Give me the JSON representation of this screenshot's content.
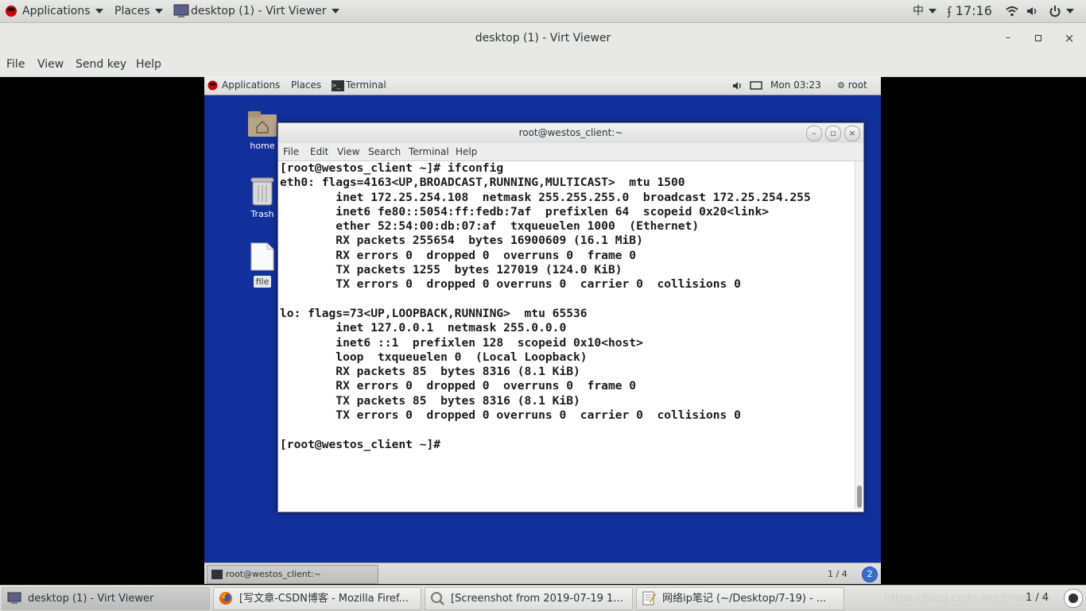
{
  "host_topbar": {
    "applications": "Applications",
    "places": "Places",
    "window_title": "desktop (1) - Virt Viewer",
    "input_method": "中",
    "clock": "17:16"
  },
  "virt_viewer": {
    "title": "desktop (1) - Virt Viewer",
    "menu": [
      "File",
      "View",
      "Send key",
      "Help"
    ],
    "minimize": "–",
    "maximize": "▫",
    "close": "×"
  },
  "guest": {
    "topbar": {
      "applications": "Applications",
      "places": "Places",
      "terminal": "Terminal",
      "clock": "Mon 03:23",
      "user": "root"
    },
    "desktop_icons": [
      "home",
      "Trash",
      "file"
    ],
    "terminal": {
      "title": "root@westos_client:~",
      "menu": [
        "File",
        "Edit",
        "View",
        "Search",
        "Terminal",
        "Help"
      ],
      "lines": [
        "[root@westos_client ~]# ifconfig",
        "eth0: flags=4163<UP,BROADCAST,RUNNING,MULTICAST>  mtu 1500",
        "        inet 172.25.254.108  netmask 255.255.255.0  broadcast 172.25.254.255",
        "        inet6 fe80::5054:ff:fedb:7af  prefixlen 64  scopeid 0x20<link>",
        "        ether 52:54:00:db:07:af  txqueuelen 1000  (Ethernet)",
        "        RX packets 255654  bytes 16900609 (16.1 MiB)",
        "        RX errors 0  dropped 0  overruns 0  frame 0",
        "        TX packets 1255  bytes 127019 (124.0 KiB)",
        "        TX errors 0  dropped 0 overruns 0  carrier 0  collisions 0",
        "",
        "lo: flags=73<UP,LOOPBACK,RUNNING>  mtu 65536",
        "        inet 127.0.0.1  netmask 255.0.0.0",
        "        inet6 ::1  prefixlen 128  scopeid 0x10<host>",
        "        loop  txqueuelen 0  (Local Loopback)",
        "        RX packets 85  bytes 8316 (8.1 KiB)",
        "        RX errors 0  dropped 0  overruns 0  frame 0",
        "        TX packets 85  bytes 8316 (8.1 KiB)",
        "        TX errors 0  dropped 0 overruns 0  carrier 0  collisions 0",
        "",
        "[root@westos_client ~]# "
      ]
    },
    "bottombar": {
      "task_label": "root@westos_client:~",
      "workspace": "1 / 4",
      "notifications": "2"
    }
  },
  "host_taskbar": {
    "tasks": [
      "desktop (1) - Virt Viewer",
      "[写文章-CSDN博客 - Mozilla Firef...",
      "[Screenshot from 2019-07-19 1...",
      "网络ip笔记 (~/Desktop/7-19) - ..."
    ],
    "watermark": "https://blog.csdn.net/bread_n",
    "workspace": "1 / 4"
  },
  "colors": {
    "guest_desktop": "#12309b",
    "host_bar": "#e8e8e7"
  }
}
